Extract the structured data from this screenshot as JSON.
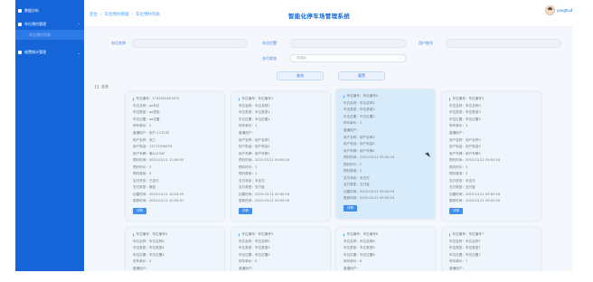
{
  "sidebar": {
    "items": [
      {
        "label": "数据分析"
      },
      {
        "label": "车位预约管理"
      },
      {
        "label": "车位预约列表"
      },
      {
        "label": "收费统计管理"
      }
    ],
    "colors": {
      "bg": "#1565d8",
      "active": "#2d79e6"
    }
  },
  "header": {
    "breadcrumb": {
      "home": "后台",
      "sep": "/",
      "level1": "车位预约管理",
      "level2": "车位预约列表"
    },
    "title": "智能化停车场管理系统",
    "user": "yonghu4"
  },
  "search": {
    "plate_label": "车位名称",
    "position_label": "车位位置",
    "username_label": "用户账号",
    "status_label": "支付状态",
    "status_placeholder": "请选择",
    "query_button": "查询",
    "reset_button": "重置"
  },
  "select_all_label": "全选",
  "cards": [
    {
      "rows": [
        "车位编号：1742522807675",
        "车位名称：aa车位",
        "车位类型：aa类型",
        "车位位置：aa位置",
        "停车单价：3",
        "普通用户：用户-113233",
        "用户名称：张三",
        "用户电话：13712345678",
        "用户车牌：粤A12345",
        "预约时间：2025-03-21 11:06:00",
        "预约时长：3",
        "预约费用：9",
        "支付状态：已支付",
        "支付类型：微信",
        "创建时间：2025-03-21 10:04:29",
        "更新时间：2025-03-21 10:04:51"
      ],
      "button": "详情"
    },
    {
      "rows": [
        "车位编号：车位编号1",
        "车位名称：车位名称1",
        "车位类型：车位类型1",
        "车位位置：车位位置1",
        "停车单价：1",
        "普通用户：",
        "用户名称：用户名称1",
        "用户电话：用户电话1",
        "用户车牌：用户车牌1",
        "预约时间：2025-03-21 09:00:16",
        "预约时长：1",
        "预约费用：1",
        "支付状态：未支付",
        "支付类型：支付宝",
        "创建时间：2025-03-21 09:00:16",
        "更新时间：2025-03-21 09:00:16"
      ],
      "button": "详情"
    },
    {
      "rows": [
        "车位编号：车位编号2",
        "车位名称：车位名称2",
        "车位类型：车位类型2",
        "车位位置：车位位置2",
        "停车单价：2",
        "普通用户：",
        "用户名称：用户名称2",
        "用户电话：用户电话2",
        "用户车牌：用户车牌2",
        "预约时间：2025-03-21 09:00:16",
        "预约时长：2",
        "预约费用：2",
        "支付状态：未支付",
        "支付类型：支付宝",
        "创建时间：2025-03-21 09:00:16",
        "更新时间：2025-03-21 09:00:16"
      ],
      "button": "详情"
    },
    {
      "rows": [
        "车位编号：车位编号3",
        "车位名称：车位名称3",
        "车位类型：车位类型3",
        "车位位置：车位位置3",
        "停车单价：3",
        "普通用户：",
        "用户名称：用户名称3",
        "用户电话：用户电话3",
        "用户车牌：用户车牌3",
        "预约时间：2025-03-21 09:00:16",
        "预约时长：3",
        "预约费用：3",
        "支付状态：未支付",
        "支付类型：支付宝",
        "创建时间：2025-03-21 09:00:16",
        "更新时间：2025-03-21 09:00:16"
      ],
      "button": "详情"
    },
    {
      "rows": [
        "车位编号：车位编号4",
        "车位名称：车位名称4",
        "车位类型：车位类型4",
        "车位位置：车位位置4",
        "停车单价：4",
        "普通用户："
      ]
    },
    {
      "rows": [
        "车位编号：车位编号5",
        "车位名称：车位名称5",
        "车位类型：车位类型5",
        "车位位置：车位位置5",
        "停车单价：5",
        "普通用户："
      ]
    },
    {
      "rows": [
        "车位编号：车位编号6",
        "车位名称：车位名称6",
        "车位类型：车位类型6",
        "车位位置：车位位置6",
        "停车单价：6",
        "普通用户："
      ]
    },
    {
      "rows": [
        "车位编号：车位编号7",
        "车位名称：车位名称7",
        "车位类型：车位类型7",
        "车位位置：车位位置7",
        "停车单价：7",
        "普通用户："
      ]
    }
  ]
}
